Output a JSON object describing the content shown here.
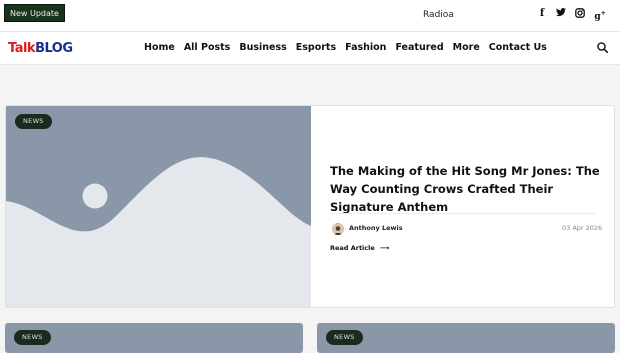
{
  "topbar": {
    "update_label": "New Update",
    "ticker_text": "Radioa",
    "socials": [
      "facebook-icon",
      "twitter-icon",
      "instagram-icon",
      "google-plus-icon"
    ]
  },
  "logo": {
    "talk": "Talk",
    "blog": "BLOG"
  },
  "nav": {
    "items": [
      "Home",
      "All Posts",
      "Business",
      "Esports",
      "Fashion",
      "Featured",
      "More",
      "Contact Us"
    ]
  },
  "featured": {
    "category": "NEWS",
    "title": "The Making of the Hit Song Mr Jones: The Way Counting Crows Crafted Their Signature Anthem",
    "author": "Anthony Lewis",
    "date": "03 Apr 2026",
    "read_more": "Read Article"
  },
  "cards": [
    {
      "category": "NEWS"
    },
    {
      "category": "NEWS"
    }
  ],
  "colors": {
    "accent_dark": "#1b2a1e",
    "placeholder_bg": "#8a97a8",
    "placeholder_fg": "#e4e7eb",
    "logo_red": "#e11b1b",
    "logo_blue": "#1a2d8c"
  }
}
